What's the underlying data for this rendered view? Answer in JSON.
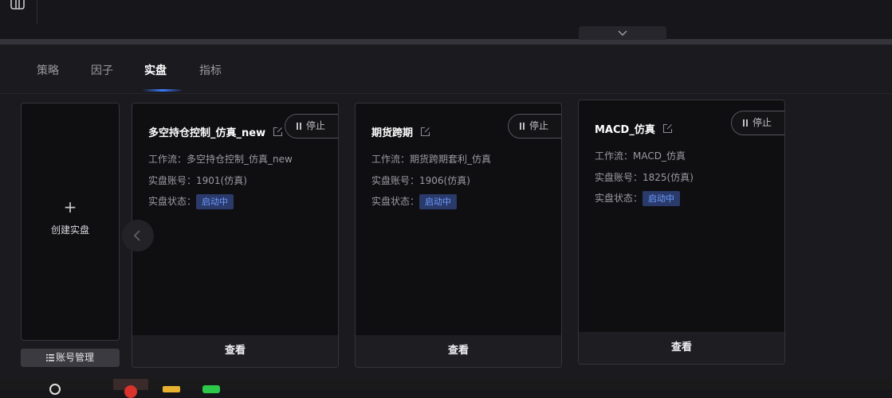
{
  "tabs": [
    {
      "label": "策略",
      "active": false
    },
    {
      "label": "因子",
      "active": false
    },
    {
      "label": "实盘",
      "active": true
    },
    {
      "label": "指标",
      "active": false
    }
  ],
  "create_card": {
    "plus": "+",
    "label": "创建实盘"
  },
  "account_button": {
    "icon": "list-icon",
    "label": "账号管理"
  },
  "field_labels": {
    "workflow": "工作流：",
    "account": "实盘账号：",
    "status": "实盘状态："
  },
  "cards": [
    {
      "title": "多空持仓控制_仿真_new",
      "workflow": "多空持仓控制_仿真_new",
      "account": "1901(仿真)",
      "status": "启动中",
      "stop_label": "停止",
      "view_label": "查看"
    },
    {
      "title": "期货跨期",
      "workflow": "期货跨期套利_仿真",
      "account": "1906(仿真)",
      "status": "启动中",
      "stop_label": "停止",
      "view_label": "查看"
    },
    {
      "title": "MACD_仿真",
      "workflow": "MACD_仿真",
      "account": "1825(仿真)",
      "status": "启动中",
      "stop_label": "停止",
      "view_label": "查看"
    }
  ],
  "colors": {
    "accent": "#3c7cff",
    "badge_bg": "#2a3a6a",
    "badge_text": "#6e9cff",
    "background": "#1a1a1f"
  }
}
